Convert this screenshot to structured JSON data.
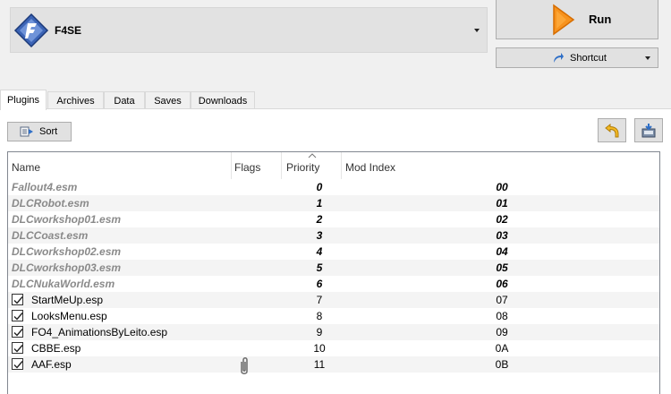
{
  "toolbar": {
    "executable": "F4SE",
    "executable_icon": "f4se-diamond-icon",
    "run_label": "Run",
    "run_icon": "play-triangle-icon",
    "shortcut_label": "Shortcut",
    "shortcut_icon": "shortcut-arrow-icon"
  },
  "tabs": [
    {
      "label": "Plugins",
      "active": true
    },
    {
      "label": "Archives",
      "active": false
    },
    {
      "label": "Data",
      "active": false
    },
    {
      "label": "Saves",
      "active": false
    },
    {
      "label": "Downloads",
      "active": false
    }
  ],
  "plugins_panel": {
    "sort_label": "Sort",
    "sort_icon": "sort-icon",
    "restore_icon": "undo-arrow-icon",
    "save_icon": "save-backup-icon"
  },
  "table": {
    "columns": {
      "name": "Name",
      "flags": "Flags",
      "priority": "Priority",
      "mod_index": "Mod Index"
    },
    "sorted_column": "Priority",
    "rows": [
      {
        "name": "Fallout4.esm",
        "priority": "0",
        "mod_index": "00",
        "locked": true,
        "checked": null,
        "flag": null
      },
      {
        "name": "DLCRobot.esm",
        "priority": "1",
        "mod_index": "01",
        "locked": true,
        "checked": null,
        "flag": null
      },
      {
        "name": "DLCworkshop01.esm",
        "priority": "2",
        "mod_index": "02",
        "locked": true,
        "checked": null,
        "flag": null
      },
      {
        "name": "DLCCoast.esm",
        "priority": "3",
        "mod_index": "03",
        "locked": true,
        "checked": null,
        "flag": null
      },
      {
        "name": "DLCworkshop02.esm",
        "priority": "4",
        "mod_index": "04",
        "locked": true,
        "checked": null,
        "flag": null
      },
      {
        "name": "DLCworkshop03.esm",
        "priority": "5",
        "mod_index": "05",
        "locked": true,
        "checked": null,
        "flag": null
      },
      {
        "name": "DLCNukaWorld.esm",
        "priority": "6",
        "mod_index": "06",
        "locked": true,
        "checked": null,
        "flag": null
      },
      {
        "name": "StartMeUp.esp",
        "priority": "7",
        "mod_index": "07",
        "locked": false,
        "checked": true,
        "flag": null
      },
      {
        "name": "LooksMenu.esp",
        "priority": "8",
        "mod_index": "08",
        "locked": false,
        "checked": true,
        "flag": null
      },
      {
        "name": "FO4_AnimationsByLeito.esp",
        "priority": "9",
        "mod_index": "09",
        "locked": false,
        "checked": true,
        "flag": null
      },
      {
        "name": "CBBE.esp",
        "priority": "10",
        "mod_index": "0A",
        "locked": false,
        "checked": true,
        "flag": null
      },
      {
        "name": "AAF.esp",
        "priority": "11",
        "mod_index": "0B",
        "locked": false,
        "checked": true,
        "flag": "paperclip-icon"
      }
    ]
  }
}
